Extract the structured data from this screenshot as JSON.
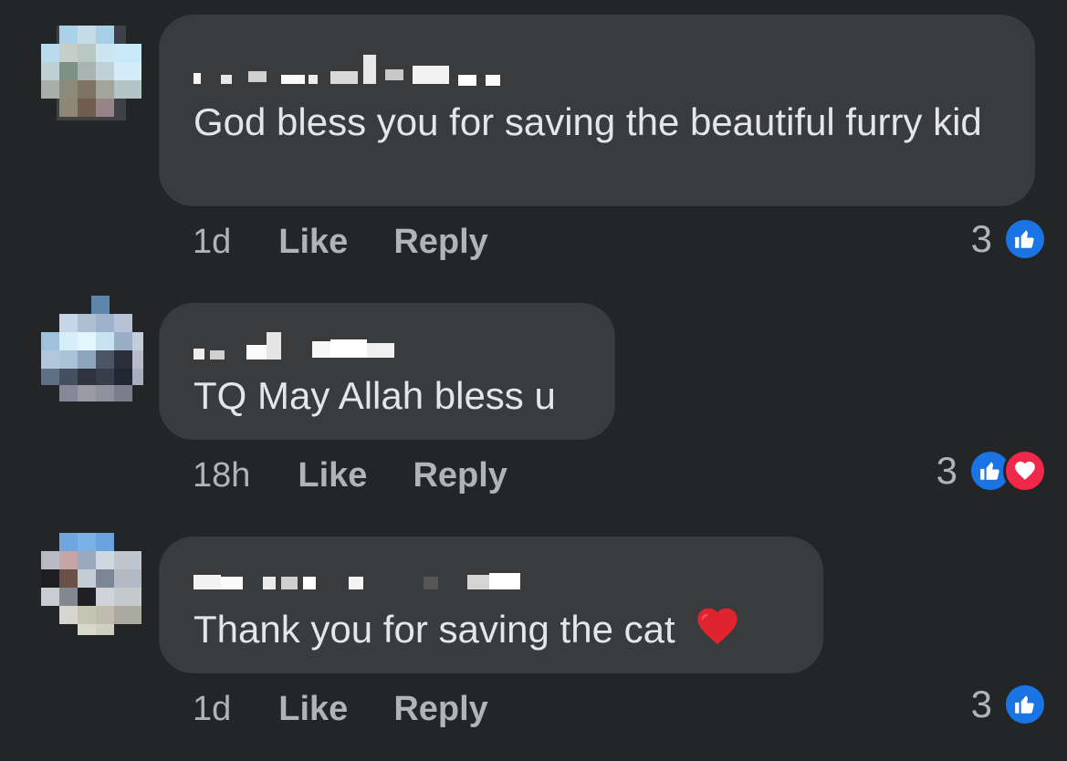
{
  "comments": [
    {
      "text": "God bless you for saving the beautiful furry kid",
      "time": "1d",
      "like_label": "Like",
      "reply_label": "Reply",
      "reaction_count": "3",
      "reactions": [
        "like-icon"
      ]
    },
    {
      "text": "TQ May Allah bless u",
      "time": "18h",
      "like_label": "Like",
      "reply_label": "Reply",
      "reaction_count": "3",
      "reactions": [
        "like-icon",
        "love-icon"
      ]
    },
    {
      "text": "Thank you for saving the cat",
      "emoji": "heart-emoji",
      "time": "1d",
      "like_label": "Like",
      "reply_label": "Reply",
      "reaction_count": "3",
      "reactions": [
        "like-icon"
      ]
    }
  ],
  "colors": {
    "background": "#242527",
    "bubble": "#3a3b3c",
    "text": "#e4e6eb",
    "meta": "#b0b3b8",
    "like_blue": "#1b74e4",
    "love_red": "#f02849"
  }
}
